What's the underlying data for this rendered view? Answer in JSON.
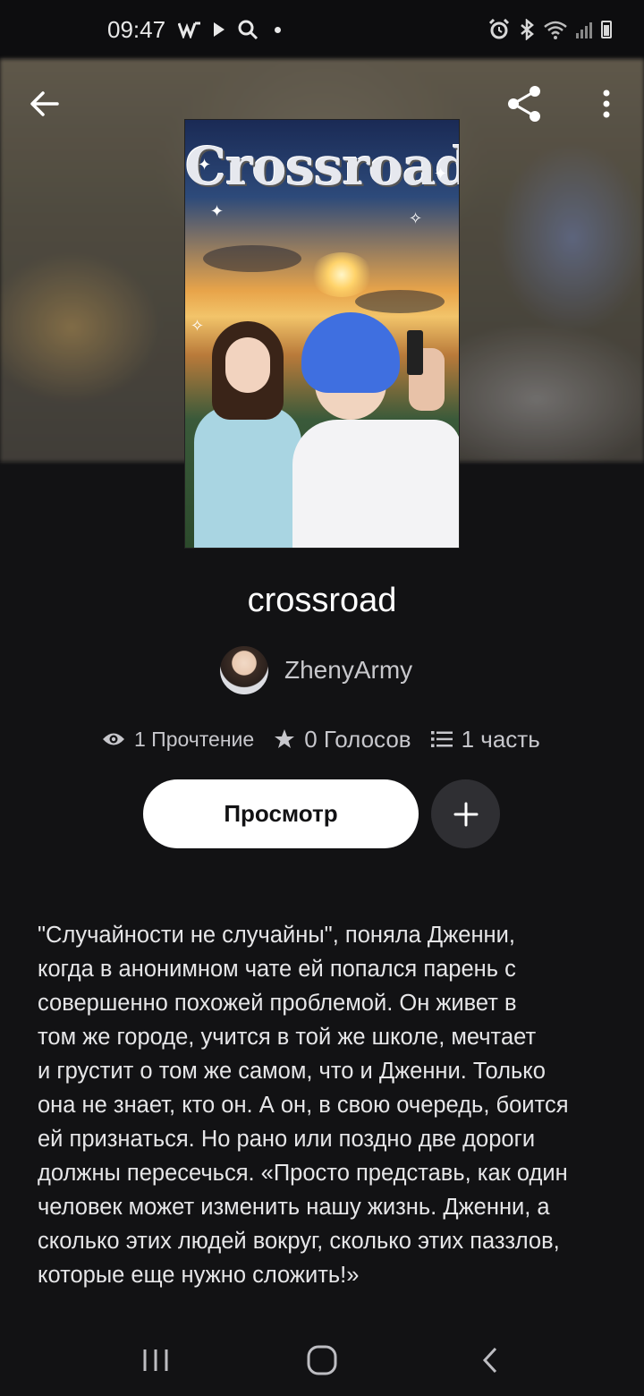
{
  "status_bar": {
    "time": "09:47",
    "left_icons": [
      "w-app-icon",
      "play-icon",
      "search-icon",
      "notification-dot"
    ],
    "right_icons": [
      "alarm-icon",
      "bluetooth-icon",
      "wifi-icon",
      "signal-icon",
      "battery-icon"
    ]
  },
  "toolbar": {
    "back_icon": "arrow-left-icon",
    "share_icon": "share-icon",
    "more_icon": "more-vertical-icon"
  },
  "cover": {
    "title_text": "Crossroad"
  },
  "book": {
    "title": "crossroad",
    "author": "ZhenyArmy"
  },
  "stats": {
    "reads": "1 Прочтение",
    "votes": "0 Голосов",
    "parts": "1 часть"
  },
  "actions": {
    "read_label": "Просмотр",
    "add_icon": "plus-icon"
  },
  "description": "\"Случайности не случайны\", поняла Дженни,\nкогда в анонимном чате ей попался парень с\nсовершенно похожей проблемой. Он живет в\nтом же городе, учится в той же школе, мечтает\nи грустит о том же самом, что и Дженни. Только\nона не знает, кто он. А он, в свою очередь, боится\nей признаться. Но рано или поздно две дороги\nдолжны пересечься. «Просто представь, как один\nчеловек может изменить нашу жизнь. Дженни, а\nсколько этих людей вокруг, сколько этих паззлов,\nкоторые еще нужно сложить!»",
  "nav_bar": {
    "recents_icon": "recents-icon",
    "home_icon": "home-icon",
    "back_icon": "nav-back-icon"
  },
  "colors": {
    "background": "#121214",
    "primary_button": "#ffffff",
    "secondary_button": "#2f2f33",
    "muted_text": "#c7c7cc"
  }
}
